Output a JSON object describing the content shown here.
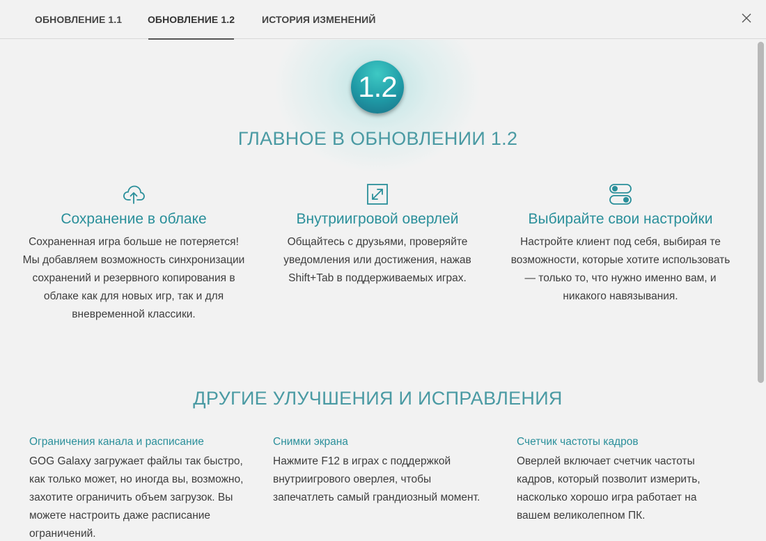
{
  "tabs": [
    {
      "label": "ОБНОВЛЕНИЕ 1.1",
      "active": false
    },
    {
      "label": "ОБНОВЛЕНИЕ 1.2",
      "active": true
    },
    {
      "label": "ИСТОРИЯ ИЗМЕНЕНИЙ",
      "active": false
    }
  ],
  "hero": {
    "badge": "1.2",
    "title": "ГЛАВНОЕ В ОБНОВЛЕНИИ 1.2"
  },
  "features": [
    {
      "icon": "cloud-upload-icon",
      "title": "Сохранение в облаке",
      "description": "Сохраненная игра больше не потеряется! Мы добавляем возможность синхронизации сохранений и резервного копирования в облаке как для новых игр, так и для вневременной классики."
    },
    {
      "icon": "expand-arrows-icon",
      "title": "Внутриигровой оверлей",
      "description": "Общайтесь с друзьями, проверяйте уведомления или достижения, нажав Shift+Tab в поддерживаемых играх."
    },
    {
      "icon": "toggles-icon",
      "title": "Выбирайте свои настройки",
      "description": "Настройте клиент под себя, выбирая те возможности, которые хотите использовать — только то, что нужно именно вам, и никакого навязывания."
    }
  ],
  "other": {
    "title": "ДРУГИЕ УЛУЧШЕНИЯ И ИСПРАВЛЕНИЯ",
    "items": [
      {
        "title": "Ограничения канала и расписание",
        "description": "GOG Galaxy загружает файлы так быстро, как только может, но иногда вы, возможно, захотите ограничить объем загрузок. Вы можете настроить даже расписание ограничений."
      },
      {
        "title": "Снимки экрана",
        "description": "Нажмите F12 в играх с поддержкой внутриигрового оверлея, чтобы запечатлеть самый грандиозный момент."
      },
      {
        "title": "Счетчик частоты кадров",
        "description": "Оверлей включает счетчик частоты кадров, который позволит измерить, насколько хорошо игра работает на вашем великолепном ПК."
      }
    ]
  },
  "colors": {
    "accent": "#2a8f9a",
    "heading": "#4a9aa3",
    "background": "#f2f2f2"
  }
}
